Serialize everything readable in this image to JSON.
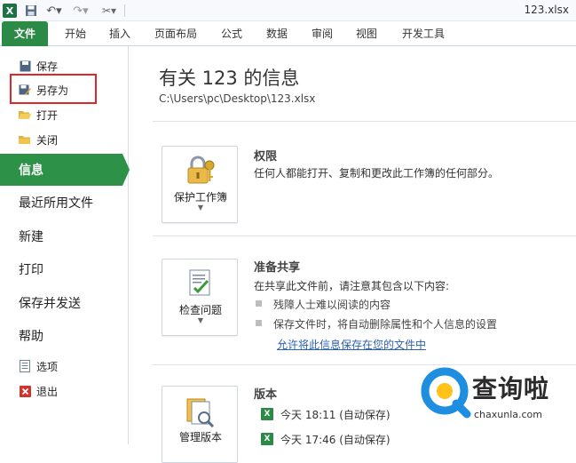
{
  "window": {
    "title": "123.xlsx"
  },
  "ribbon": {
    "tabs": [
      "文件",
      "开始",
      "插入",
      "页面布局",
      "公式",
      "数据",
      "审阅",
      "视图",
      "开发工具"
    ]
  },
  "backstage": {
    "commands": {
      "save": "保存",
      "save_as": "另存为",
      "open": "打开",
      "close": "关闭"
    },
    "nav": {
      "info": "信息",
      "recent": "最近所用文件",
      "new": "新建",
      "print": "打印",
      "save_send": "保存并发送",
      "help": "帮助"
    },
    "footer": {
      "options": "选项",
      "exit": "退出"
    }
  },
  "info": {
    "title": "有关 123 的信息",
    "path": "C:\\Users\\pc\\Desktop\\123.xlsx",
    "permissions": {
      "button": "保护工作簿",
      "title": "权限",
      "desc": "任何人都能打开、复制和更改此工作簿的任何部分。"
    },
    "prepare": {
      "button": "检查问题",
      "title": "准备共享",
      "desc": "在共享此文件前，请注意其包含以下内容:",
      "bullets": [
        "残障人士难以阅读的内容",
        "保存文件时，将自动删除属性和个人信息的设置"
      ],
      "link": "允许将此信息保存在您的文件中"
    },
    "versions": {
      "button": "管理版本",
      "title": "版本",
      "items": [
        "今天 18:11 (自动保存)",
        "今天 17:46 (自动保存)"
      ]
    }
  },
  "watermark": {
    "text": "查询啦",
    "url": "chaxunla.com"
  },
  "colors": {
    "file_tab": "#2a8a46",
    "nav_selected": "#2e9148",
    "highlight": "#e02626"
  }
}
